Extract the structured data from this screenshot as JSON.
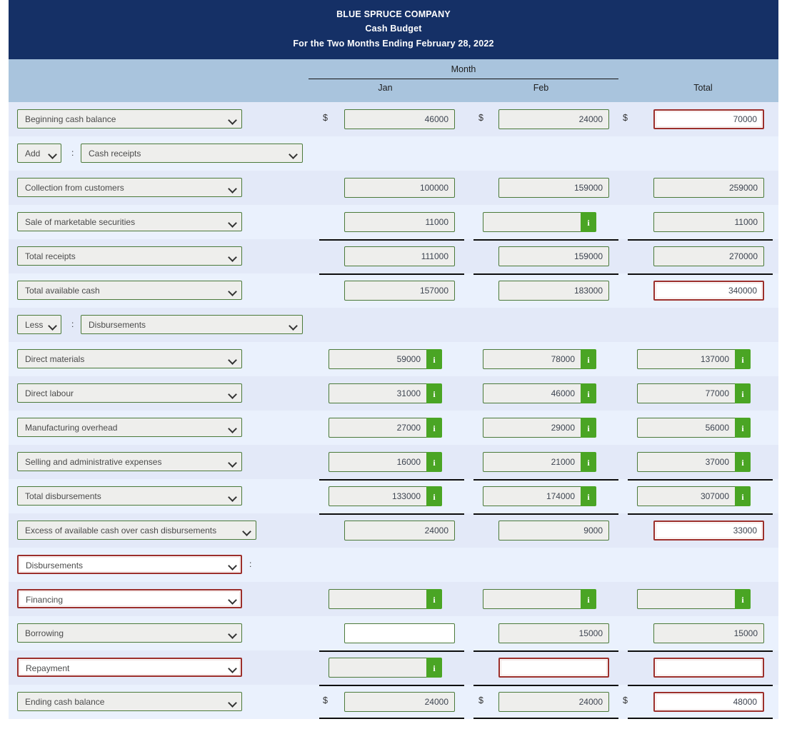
{
  "report": {
    "company": "BLUE SPRUCE COMPANY",
    "statement": "Cash Budget",
    "period": "For the Two Months Ending February 28, 2022"
  },
  "columns": {
    "group": "Month",
    "jan": "Jan",
    "feb": "Feb",
    "total": "Total",
    "currency_symbol": "$"
  },
  "icons": {
    "info": "i",
    "chevron": "chevron-down-icon"
  },
  "rows": [
    {
      "id": "beginning-cash-balance",
      "kind": "value",
      "label": "Beginning cash balance",
      "dollar": true,
      "jan": {
        "value": "46000",
        "state": "ok"
      },
      "feb": {
        "value": "24000",
        "state": "ok"
      },
      "total": {
        "value": "70000",
        "state": "error"
      }
    },
    {
      "id": "add-cash-receipts",
      "kind": "section",
      "operator": "Add",
      "colon": ":",
      "label": "Cash receipts"
    },
    {
      "id": "collection-from-customers",
      "kind": "value",
      "label": "Collection from customers",
      "jan": {
        "value": "100000",
        "state": "ok"
      },
      "feb": {
        "value": "159000",
        "state": "ok"
      },
      "total": {
        "value": "259000",
        "state": "ok"
      }
    },
    {
      "id": "sale-of-marketable-securities",
      "kind": "value",
      "label": "Sale of marketable securities",
      "jan": {
        "value": "11000",
        "state": "ok"
      },
      "feb": {
        "value": "",
        "state": "ok",
        "info": true
      },
      "total": {
        "value": "11000",
        "state": "ok"
      }
    },
    {
      "id": "total-receipts",
      "kind": "value",
      "label": "Total receipts",
      "rule_above": true,
      "jan": {
        "value": "111000",
        "state": "ok"
      },
      "feb": {
        "value": "159000",
        "state": "ok"
      },
      "total": {
        "value": "270000",
        "state": "ok"
      }
    },
    {
      "id": "total-available-cash",
      "kind": "value",
      "label": "Total available cash",
      "rule_above": true,
      "jan": {
        "value": "157000",
        "state": "ok"
      },
      "feb": {
        "value": "183000",
        "state": "ok"
      },
      "total": {
        "value": "340000",
        "state": "error"
      }
    },
    {
      "id": "less-disbursements",
      "kind": "section",
      "operator": "Less",
      "colon": ":",
      "label": "Disbursements"
    },
    {
      "id": "direct-materials",
      "kind": "value",
      "label": "Direct materials",
      "jan": {
        "value": "59000",
        "state": "ok",
        "info": true
      },
      "feb": {
        "value": "78000",
        "state": "ok",
        "info": true
      },
      "total": {
        "value": "137000",
        "state": "ok",
        "info": true
      }
    },
    {
      "id": "direct-labour",
      "kind": "value",
      "label": "Direct labour",
      "jan": {
        "value": "31000",
        "state": "ok",
        "info": true
      },
      "feb": {
        "value": "46000",
        "state": "ok",
        "info": true
      },
      "total": {
        "value": "77000",
        "state": "ok",
        "info": true
      }
    },
    {
      "id": "manufacturing-overhead",
      "kind": "value",
      "label": "Manufacturing overhead",
      "jan": {
        "value": "27000",
        "state": "ok",
        "info": true
      },
      "feb": {
        "value": "29000",
        "state": "ok",
        "info": true
      },
      "total": {
        "value": "56000",
        "state": "ok",
        "info": true
      }
    },
    {
      "id": "selling-and-administrative-expenses",
      "kind": "value",
      "label": "Selling and administrative expenses",
      "jan": {
        "value": "16000",
        "state": "ok",
        "info": true
      },
      "feb": {
        "value": "21000",
        "state": "ok",
        "info": true
      },
      "total": {
        "value": "37000",
        "state": "ok",
        "info": true
      }
    },
    {
      "id": "total-disbursements",
      "kind": "value",
      "label": "Total disbursements",
      "rule_above": true,
      "jan": {
        "value": "133000",
        "state": "ok",
        "info": true
      },
      "feb": {
        "value": "174000",
        "state": "ok",
        "info": true
      },
      "total": {
        "value": "307000",
        "state": "ok",
        "info": true
      }
    },
    {
      "id": "excess-of-available-cash-over-cash-disbursements",
      "kind": "value",
      "label": "Excess of available cash over cash disbursements",
      "wide_label": true,
      "rule_above": true,
      "jan": {
        "value": "24000",
        "state": "ok"
      },
      "feb": {
        "value": "9000",
        "state": "ok"
      },
      "total": {
        "value": "33000",
        "state": "error"
      }
    },
    {
      "id": "disbursements-heading",
      "kind": "heading",
      "label": "Disbursements",
      "label_state": "error",
      "colon": ":"
    },
    {
      "id": "financing",
      "kind": "value",
      "label": "Financing",
      "label_state": "error",
      "jan": {
        "value": "",
        "state": "ok",
        "info": true
      },
      "feb": {
        "value": "",
        "state": "ok",
        "info": true
      },
      "total": {
        "value": "",
        "state": "ok",
        "info": true
      }
    },
    {
      "id": "borrowing",
      "kind": "value",
      "label": "Borrowing",
      "jan": {
        "value": "",
        "state": "blank"
      },
      "feb": {
        "value": "15000",
        "state": "ok"
      },
      "total": {
        "value": "15000",
        "state": "ok"
      }
    },
    {
      "id": "repayment",
      "kind": "value",
      "label": "Repayment",
      "label_state": "error",
      "rule_above": true,
      "jan": {
        "value": "",
        "state": "ok",
        "info": true
      },
      "feb": {
        "value": "",
        "state": "error"
      },
      "total": {
        "value": "",
        "state": "error"
      }
    },
    {
      "id": "ending-cash-balance",
      "kind": "value",
      "label": "Ending cash balance",
      "dollar": true,
      "rule_above": true,
      "rule_below": true,
      "jan": {
        "value": "24000",
        "state": "ok"
      },
      "feb": {
        "value": "24000",
        "state": "ok"
      },
      "total": {
        "value": "48000",
        "state": "error"
      }
    }
  ]
}
